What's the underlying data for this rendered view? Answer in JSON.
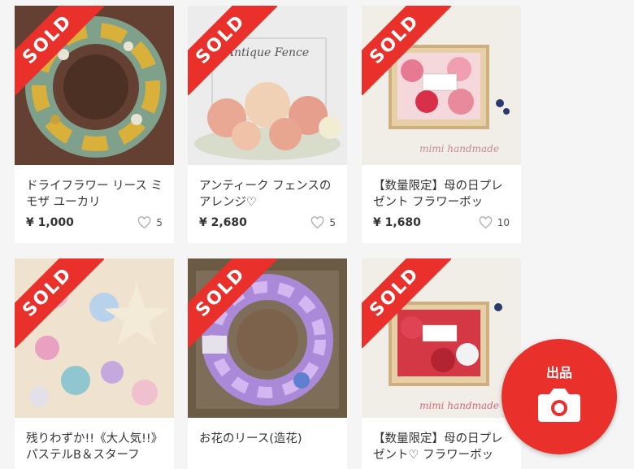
{
  "products": [
    {
      "title": "ドライフラワー リース ミモザ ユーカリ",
      "price": "¥ 1,000",
      "likes": "5",
      "sold_label": "SOLD"
    },
    {
      "title": "アンティーク フェンスのアレンジ♡",
      "price": "¥ 2,680",
      "likes": "5",
      "sold_label": "SOLD",
      "image_text": "Antique Fence"
    },
    {
      "title": "【数量限定】母の日プレゼント フラワーボッ",
      "price": "¥ 1,680",
      "likes": "10",
      "sold_label": "SOLD",
      "image_text": "mimi handmade"
    },
    {
      "title": "残りわずか!!《大人気!!》パステルB＆スターフ",
      "sold_label": "SOLD"
    },
    {
      "title": "お花のリース(造花)",
      "sold_label": "SOLD"
    },
    {
      "title": "【数量限定】母の日プレゼント♡ フラワーボッ",
      "sold_label": "SOLD",
      "image_text": "mimi handmade"
    }
  ],
  "sell_button": {
    "label": "出品",
    "icon": "camera-icon"
  },
  "colors": {
    "accent": "#e9302b",
    "background": "#f5f5f5"
  }
}
